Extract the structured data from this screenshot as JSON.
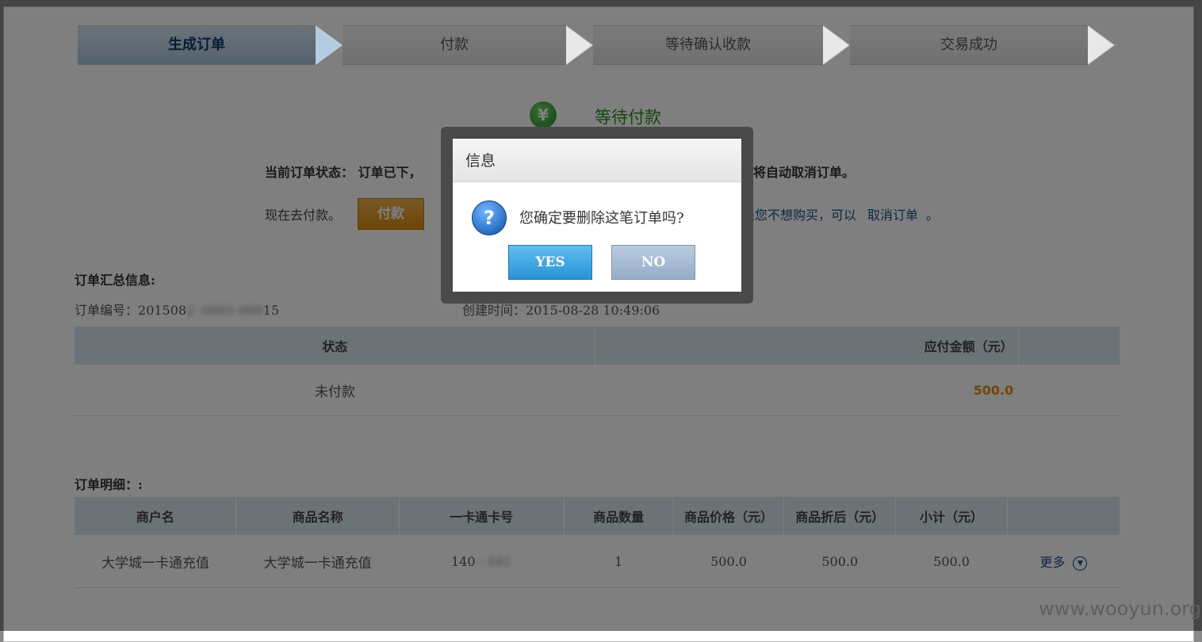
{
  "steps": [
    {
      "label": "生成订单"
    },
    {
      "label": "付款"
    },
    {
      "label": "等待确认收款"
    },
    {
      "label": "交易成功"
    }
  ],
  "status": {
    "icon": "yen-icon",
    "title": "等待付款",
    "current_prefix": "当前订单状态：  订单已下，",
    "current_tail": "统将自动取消订单。",
    "pay_prompt": "现在去付款。",
    "pay_button": "付款",
    "cancel_prefix": "果您不想购买，可以",
    "cancel_link": "取消订单",
    "cancel_suffix": "。"
  },
  "summary": {
    "title": "订单汇总信息:",
    "order_no_label": "订单编号：",
    "order_no_visible_start": "201508",
    "order_no_blurred": "2··0001·000",
    "order_no_visible_end": "15",
    "created_label": "创建时间：",
    "created_value": "2015-08-28 10:49:06",
    "headers": [
      "状态",
      "应付金额（元）"
    ],
    "row": {
      "status": "未付款",
      "amount": "500.0"
    }
  },
  "detail": {
    "title": "订单明细：:",
    "headers": [
      "商户名",
      "商品名称",
      "一卡通卡号",
      "商品数量",
      "商品价格（元）",
      "商品折后（元）",
      "小计（元）",
      ""
    ],
    "row": {
      "merchant": "大学城一卡通充值",
      "product": "大学城一卡通充值",
      "card_visible": "140",
      "card_blurred": "···161",
      "qty": "1",
      "price": "500.0",
      "discount": "500.0",
      "subtotal": "500.0",
      "more": "更多"
    }
  },
  "dialog": {
    "title": "信息",
    "message": "您确定要删除这笔订单吗?",
    "yes": "YES",
    "no": "NO"
  },
  "watermark": "www.wooyun.org"
}
